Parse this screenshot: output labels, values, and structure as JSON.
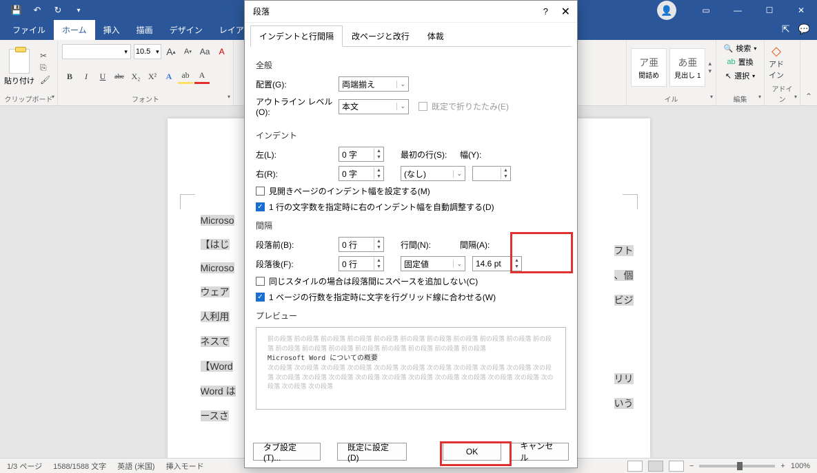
{
  "titlebar": {},
  "tabs": {
    "file": "ファイル",
    "home": "ホーム",
    "insert": "挿入",
    "draw": "描画",
    "design": "デザイン",
    "layout": "レイアウト"
  },
  "ribbon": {
    "clipboard": {
      "paste": "貼り付け",
      "label": "クリップボード"
    },
    "font": {
      "name": "",
      "size": "10.5",
      "bold": "B",
      "italic": "I",
      "under": "U",
      "strike": "abc",
      "sub": "X₂",
      "sup": "X²",
      "Aa": "Aa",
      "clear": "A",
      "Alarge": "A",
      "Asmall": "A",
      "hiA": "A",
      "colorA": "A",
      "label": "フォント"
    },
    "style": {
      "s1": "ア亜",
      "s1l": "間詰め",
      "s2": "あ亜",
      "s2l": "見出し 1",
      "label": "イル"
    },
    "edit": {
      "find": "検索",
      "replace": "置換",
      "select": "選択",
      "label": "編集"
    },
    "addin": {
      "label": "アドイン",
      "btn": "アド\nイン"
    }
  },
  "doc": {
    "l1": "Microso",
    "l2": "【はじ",
    "l3": "Microso",
    "l4": "ウェア",
    "l5": "人利用",
    "l6": "ネスで",
    "l7": "【Word",
    "l8": "Word は",
    "l9": "ースさ",
    "r1": "フト",
    "r2": "、個",
    "r3": "ビジ",
    "r4": "リリ",
    "r5": "いう"
  },
  "dialog": {
    "title": "段落",
    "tabs": {
      "t1": "インデントと行間隔",
      "t2": "改ページと改行",
      "t3": "体裁"
    },
    "general": "全般",
    "alignment_label": "配置(G):",
    "alignment_value": "両端揃え",
    "outline_label": "アウトライン レベル(O):",
    "outline_value": "本文",
    "collapse": "既定で折りたたみ(E)",
    "indent": "インデント",
    "left_label": "左(L):",
    "left_value": "0 字",
    "right_label": "右(R):",
    "right_value": "0 字",
    "first_label": "最初の行(S):",
    "first_value": "(なし)",
    "width_label": "幅(Y):",
    "width_value": "",
    "mirror": "見開きページのインデント幅を設定する(M)",
    "autoadjust": "1 行の文字数を指定時に右のインデント幅を自動調整する(D)",
    "spacing": "間隔",
    "before_label": "段落前(B):",
    "before_value": "0 行",
    "after_label": "段落後(F):",
    "after_value": "0 行",
    "linespace_label": "行間(N):",
    "linespace_value": "固定値",
    "at_label": "間隔(A):",
    "at_value": "14.6 pt",
    "samestyle": "同じスタイルの場合は段落間にスペースを追加しない(C)",
    "gridalign": "1 ページの行数を指定時に文字を行グリッド線に合わせる(W)",
    "preview_title": "プレビュー",
    "preview_before": "前の段落 前の段落 前の段落 前の段落 前の段落 前の段落 前の段落 前の段落 前の段落 前の段落 前の段落 前の段落 前の段落 前の段落 前の段落 前の段落 前の段落 前の段落 前の段落",
    "preview_sample": "Microsoft Word についての概要",
    "preview_after": "次の段落 次の段落 次の段落 次の段落 次の段落 次の段落 次の段落 次の段落 次の段落 次の段落 次の段落 次の段落 次の段落 次の段落 次の段落 次の段落 次の段落 次の段落 次の段落 次の段落 次の段落 次の段落 次の段落 次の段落",
    "tabs_btn": "タブ設定(T)...",
    "default_btn": "既定に設定(D)",
    "ok": "OK",
    "cancel": "キャンセル"
  },
  "status": {
    "page": "1/3 ページ",
    "words": "1588/1588 文字",
    "lang": "英語 (米国)",
    "mode": "挿入モード",
    "zoom": "100%"
  }
}
